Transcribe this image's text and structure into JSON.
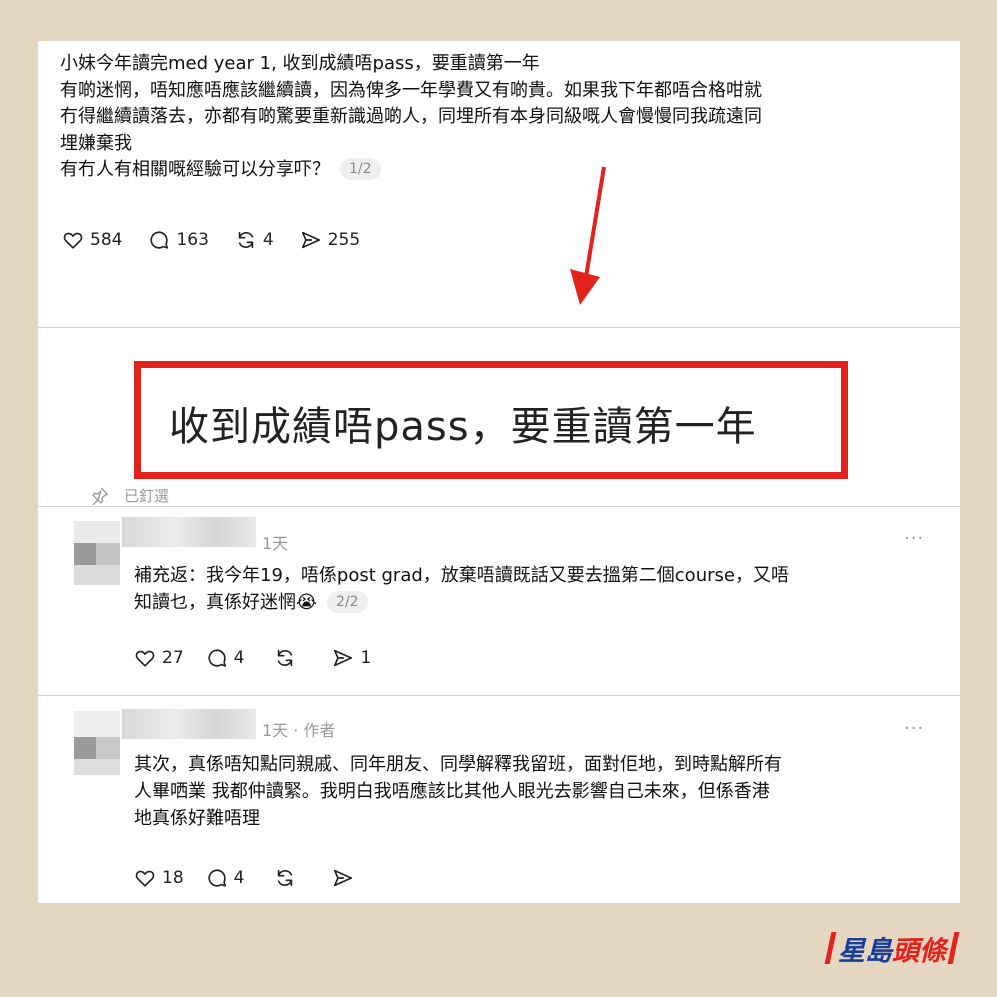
{
  "post": {
    "lines": [
      "小妹今年讀完med year 1, 收到成績唔pass，要重讀第一年",
      "有啲迷惘，唔知應唔應該繼續讀，因為俾多一年學費又有啲貴。如果我下年都唔合格咁就",
      "冇得繼續讀落去，亦都有啲驚要重新識過啲人，同埋所有本身同級嘅人會慢慢同我疏遠同",
      "埋嫌棄我",
      "有冇人有相關嘅經驗可以分享吓？"
    ],
    "page": "1/2",
    "stats": {
      "likes": "584",
      "comments": "163",
      "reposts": "4",
      "shares": "255"
    }
  },
  "zoom": {
    "text": "收到成績唔pass，要重讀第一年"
  },
  "pinned": {
    "label": "已釘選"
  },
  "reply1": {
    "time": "1天",
    "more": "···",
    "lines": [
      "補充返：我今年19，唔係post grad，放棄唔讀既話又要去搵第二個course，又唔",
      "知讀乜，真係好迷惘😭"
    ],
    "page": "2/2",
    "stats": {
      "likes": "27",
      "comments": "4",
      "shares": "1"
    }
  },
  "reply2": {
    "time": "1天 · 作者",
    "more": "···",
    "lines": [
      "其次，真係唔知點同親戚、同年朋友、同學解釋我留班，面對佢地，到時點解所有",
      "人畢哂業 我都仲讀緊。我明白我唔應該比其他人眼光去影響自己未來，但係香港",
      "地真係好難唔理"
    ],
    "stats": {
      "likes": "18",
      "comments": "4"
    }
  },
  "logo": {
    "part1": "星島",
    "part2": "頭條"
  },
  "colors": {
    "highlight": "#e4221c",
    "background": "#e4d6c0",
    "brand_blue": "#1a3e97"
  }
}
